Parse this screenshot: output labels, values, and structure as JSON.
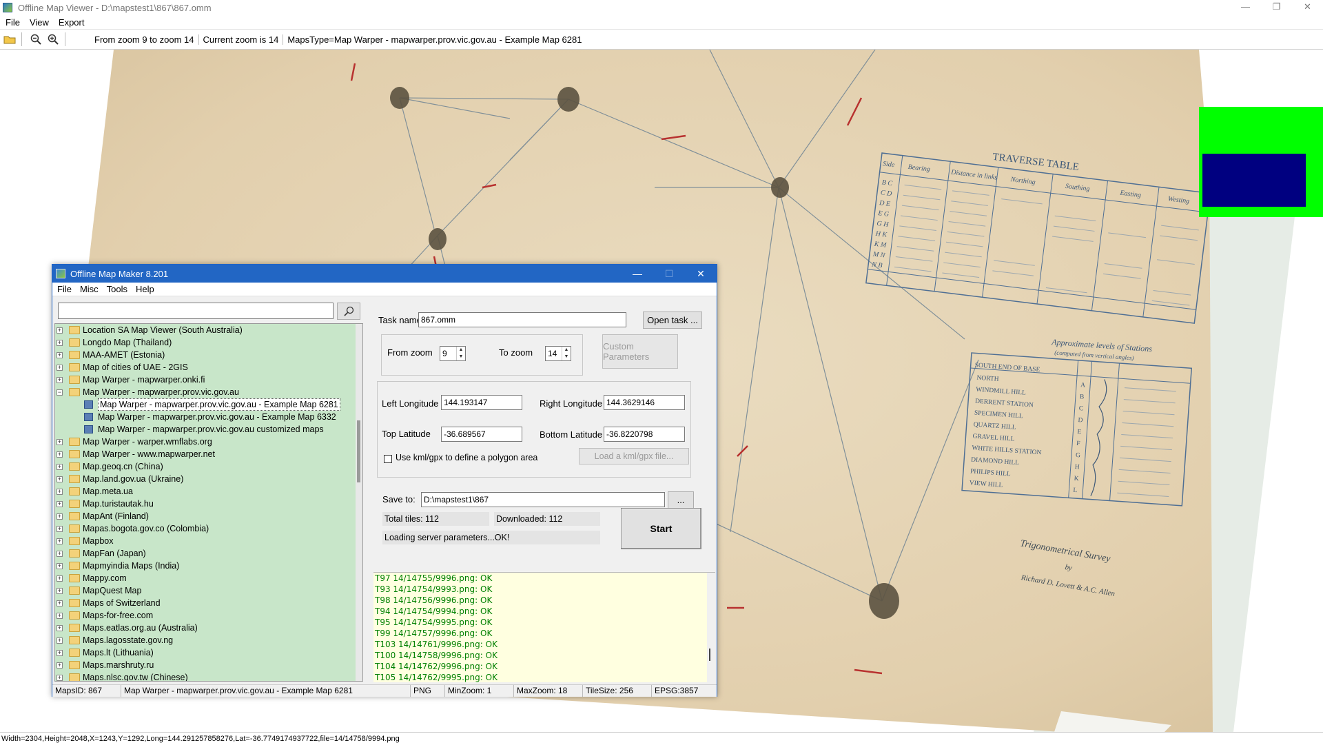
{
  "viewer": {
    "title": "Offline Map Viewer - D:\\mapstest1\\867\\867.omm",
    "window_controls": {
      "minimize": "—",
      "restore": "❐",
      "close": "✕"
    },
    "menu": [
      "File",
      "View",
      "Export"
    ],
    "toolbar": {
      "zoom_range": "From zoom 9 to zoom 14",
      "current_zoom": "Current zoom is 14",
      "maps_type": "MapsType=Map Warper - mapwarper.prov.vic.gov.au - Example Map 6281"
    },
    "status": "Width=2304,Height=2048,X=1243,Y=1292,Long=144.291257858276,Lat=-36.7749174937722,file=14/14758/9994.png",
    "minimap_colors": {
      "background": "#00ff00",
      "viewport": "#000080"
    }
  },
  "map_text": {
    "table_title": "TRAVERSE TABLE",
    "levels_title": "Approximate levels of Stations",
    "levels_sub": "(computed from vertical angles)",
    "survey_title": "Trigonometrical Survey",
    "survey_by": "by",
    "survey_authors": "Richard D. Lovett & A.C. Allen",
    "traverse_headers": [
      "Side",
      "Bearing",
      "Distance in links",
      "Northing",
      "Southing",
      "Easting",
      "Westing"
    ],
    "traverse_sides": [
      "B C",
      "C D",
      "D E",
      "E G",
      "G H",
      "H K",
      "K M",
      "M N",
      "N B"
    ],
    "stations": [
      "SOUTH END OF BASE",
      "NORTH",
      "WINDMILL HILL",
      "DERRENT STATION",
      "SPECIMEN HILL",
      "QUARTZ HILL",
      "GRAVEL HILL",
      "WHITE HILLS STATION",
      "DIAMOND HILL",
      "PHILIPS HILL",
      "VIEW HILL"
    ],
    "station_letters": [
      "A",
      "B",
      "C",
      "D",
      "E",
      "F",
      "G",
      "H",
      "K",
      "L"
    ]
  },
  "omm": {
    "title": "Offline Map Maker 8.201",
    "window_controls": {
      "minimize": "—",
      "maximize": "☐",
      "close": "✕"
    },
    "menu": [
      "File",
      "Misc",
      "Tools",
      "Help"
    ],
    "search": {
      "value": "",
      "placeholder": ""
    },
    "tree": [
      {
        "label": "Location SA Map Viewer (South Australia)",
        "expander": "+",
        "level": 0
      },
      {
        "label": "Longdo Map (Thailand)",
        "expander": "+",
        "level": 0
      },
      {
        "label": "MAA-AMET (Estonia)",
        "expander": "+",
        "level": 0
      },
      {
        "label": "Map of cities of UAE - 2GIS",
        "expander": "+",
        "level": 0
      },
      {
        "label": "Map Warper - mapwarper.onki.fi",
        "expander": "+",
        "level": 0
      },
      {
        "label": "Map Warper - mapwarper.prov.vic.gov.au",
        "expander": "−",
        "level": 0
      },
      {
        "label": "Map Warper - mapwarper.prov.vic.gov.au - Example Map 6281",
        "expander": "",
        "level": 1,
        "selected": true
      },
      {
        "label": "Map Warper - mapwarper.prov.vic.gov.au - Example Map 6332",
        "expander": "",
        "level": 1
      },
      {
        "label": "Map Warper - mapwarper.prov.vic.gov.au customized maps",
        "expander": "",
        "level": 1
      },
      {
        "label": "Map Warper - warper.wmflabs.org",
        "expander": "+",
        "level": 0
      },
      {
        "label": "Map Warper - www.mapwarper.net",
        "expander": "+",
        "level": 0
      },
      {
        "label": "Map.geoq.cn (China)",
        "expander": "+",
        "level": 0
      },
      {
        "label": "Map.land.gov.ua (Ukraine)",
        "expander": "+",
        "level": 0
      },
      {
        "label": "Map.meta.ua",
        "expander": "+",
        "level": 0
      },
      {
        "label": "Map.turistautak.hu",
        "expander": "+",
        "level": 0
      },
      {
        "label": "MapAnt (Finland)",
        "expander": "+",
        "level": 0
      },
      {
        "label": "Mapas.bogota.gov.co (Colombia)",
        "expander": "+",
        "level": 0
      },
      {
        "label": "Mapbox",
        "expander": "+",
        "level": 0
      },
      {
        "label": "MapFan (Japan)",
        "expander": "+",
        "level": 0
      },
      {
        "label": "Mapmyindia Maps (India)",
        "expander": "+",
        "level": 0
      },
      {
        "label": "Mappy.com",
        "expander": "+",
        "level": 0
      },
      {
        "label": "MapQuest Map",
        "expander": "+",
        "level": 0
      },
      {
        "label": "Maps of Switzerland",
        "expander": "+",
        "level": 0
      },
      {
        "label": "Maps-for-free.com",
        "expander": "+",
        "level": 0
      },
      {
        "label": "Maps.eatlas.org.au (Australia)",
        "expander": "+",
        "level": 0
      },
      {
        "label": "Maps.lagosstate.gov.ng",
        "expander": "+",
        "level": 0
      },
      {
        "label": "Maps.lt (Lithuania)",
        "expander": "+",
        "level": 0
      },
      {
        "label": "Maps.marshruty.ru",
        "expander": "+",
        "level": 0
      },
      {
        "label": "Maps.nlsc.gov.tw (Chinese)",
        "expander": "+",
        "level": 0
      }
    ],
    "task": {
      "label": "Task name",
      "value": "867.omm",
      "open_button": "Open task ..."
    },
    "zoom": {
      "from_label": "From zoom",
      "from_value": "9",
      "to_label": "To zoom",
      "to_value": "14",
      "custom_button": "Custom Parameters"
    },
    "bounds": {
      "left_lon_label": "Left Longitude",
      "left_lon": "144.193147",
      "right_lon_label": "Right Longitude",
      "right_lon": "144.3629146",
      "top_lat_label": "Top Latitude",
      "top_lat": "-36.689567",
      "bottom_lat_label": "Bottom Latitude",
      "bottom_lat": "-36.8220798",
      "kml_checkbox_label": "Use kml/gpx to define a polygon area",
      "kml_checked": false,
      "kml_button": "Load a kml/gpx file..."
    },
    "save": {
      "label": "Save to:",
      "value": "D:\\mapstest1\\867",
      "browse": "..."
    },
    "progress": {
      "total": "Total tiles: 112",
      "downloaded": "Downloaded: 112",
      "message": "Loading server parameters...OK!"
    },
    "start_button": "Start",
    "log": [
      "T97 14/14755/9996.png: OK",
      "T93 14/14754/9993.png: OK",
      "T98 14/14756/9996.png: OK",
      "T94 14/14754/9994.png: OK",
      "T95 14/14754/9995.png: OK",
      "T99 14/14757/9996.png: OK",
      "T103 14/14761/9996.png: OK",
      "T100 14/14758/9996.png: OK",
      "T104 14/14762/9996.png: OK",
      "T105 14/14762/9995.png: OK"
    ],
    "status": {
      "maps_id": "MapsID: 867",
      "name": "Map Warper - mapwarper.prov.vic.gov.au - Example Map 6281",
      "format": "PNG",
      "min_zoom": "MinZoom: 1",
      "max_zoom": "MaxZoom: 18",
      "tile_size": "TileSize: 256",
      "epsg": "EPSG:3857"
    }
  }
}
